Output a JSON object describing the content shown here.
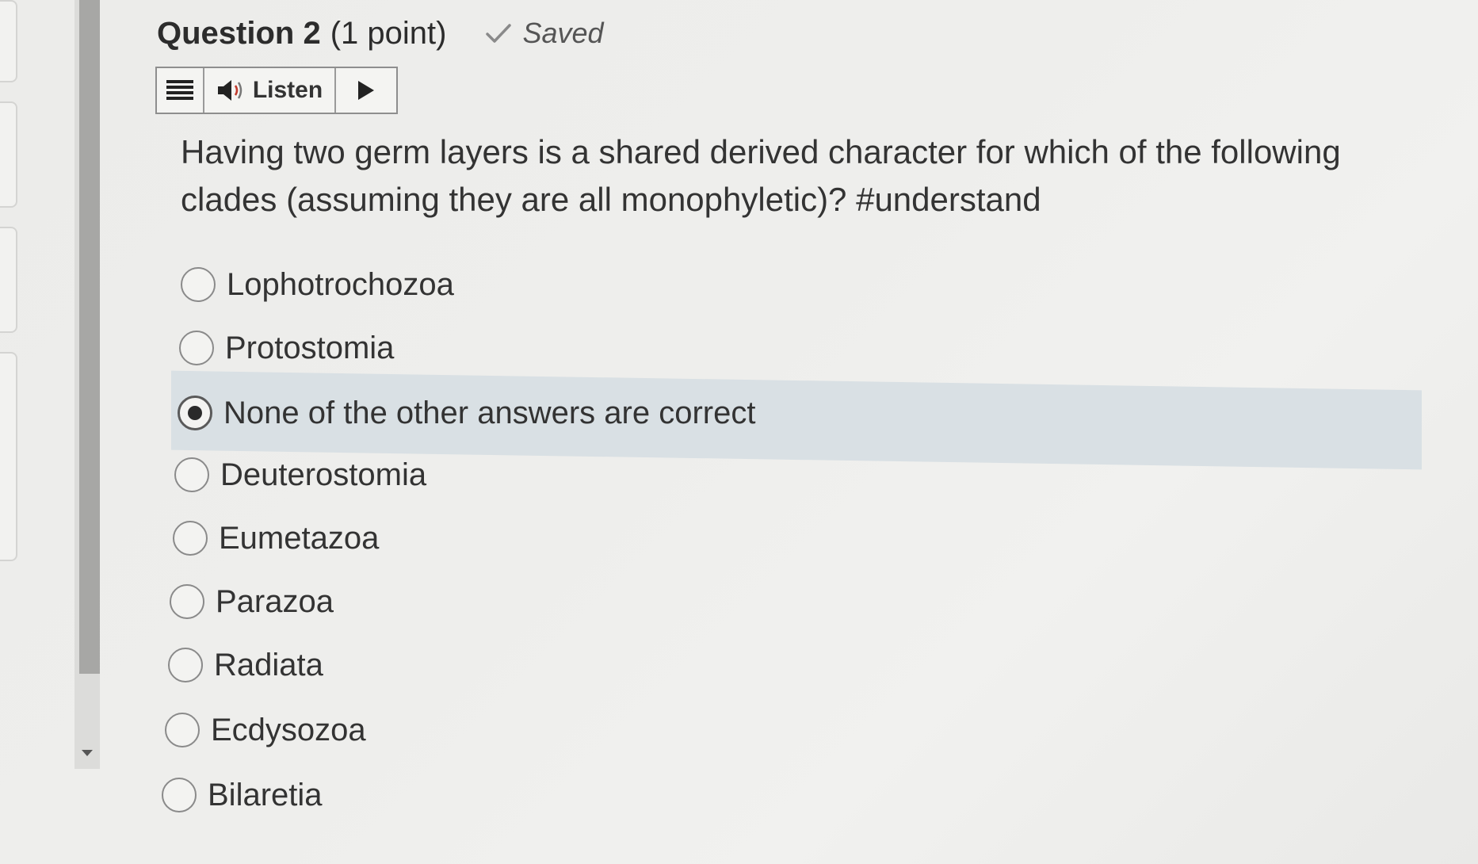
{
  "header": {
    "title": "Question 2",
    "points": "(1 point)",
    "saved_status": "Saved"
  },
  "toolbar": {
    "menu_icon": "menu-lines-icon",
    "listen_icon": "speaker-icon",
    "listen_label": "Listen",
    "play_icon": "play-icon"
  },
  "question": {
    "text": "Having two germ layers is a shared derived character for which of the following clades (assuming they are all monophyletic)? #understand"
  },
  "options": [
    {
      "label": "Lophotrochozoa",
      "selected": false
    },
    {
      "label": "Protostomia",
      "selected": false
    },
    {
      "label": "None of the other answers are correct",
      "selected": true
    },
    {
      "label": "Deuterostomia",
      "selected": false
    },
    {
      "label": "Eumetazoa",
      "selected": false
    },
    {
      "label": "Parazoa",
      "selected": false
    },
    {
      "label": "Radiata",
      "selected": false
    },
    {
      "label": "Ecdysozoa",
      "selected": false
    },
    {
      "label": "Bilaretia",
      "selected": false
    }
  ],
  "colors": {
    "selected_row": "#d9e0e4",
    "text": "#333333",
    "scrollbar_thumb": "#a7a7a5"
  }
}
